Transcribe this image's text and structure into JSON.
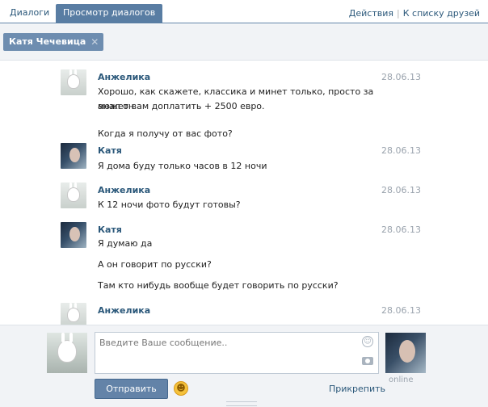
{
  "tabs": [
    {
      "label": "Диалоги"
    },
    {
      "label": "Просмотр диалогов"
    }
  ],
  "header_links": {
    "actions": "Действия",
    "back_to_friends": "К списку друзей"
  },
  "chip": {
    "label": "Катя Чечевица"
  },
  "messages": [
    {
      "author": "Анжелика",
      "date": "28.06.13",
      "avatar": "bunny-avatar",
      "lines": [
        "Хорошо, как скажете, классика и минет только, просто за анал он",
        "может вам доплатить + 2500 евро.",
        "Когда я получу от вас фото?"
      ]
    },
    {
      "author": "Катя",
      "date": "28.06.13",
      "avatar": "girl-avatar",
      "lines": [
        "Я дома буду только часов в 12 ночи"
      ]
    },
    {
      "author": "Анжелика",
      "date": "28.06.13",
      "avatar": "bunny-avatar",
      "lines": [
        "К 12 ночи фото будут готовы?"
      ]
    },
    {
      "author": "Катя",
      "date": "28.06.13",
      "avatar": "girl-avatar",
      "lines": [
        "Я думаю да",
        "А он говорит по русски?",
        "Там кто нибудь вообще будет говорить по русски?"
      ]
    },
    {
      "author": "Анжелика",
      "date": "28.06.13",
      "avatar": "bunny-avatar",
      "lines": []
    }
  ],
  "composer": {
    "placeholder": "Введите Ваше сообщение..",
    "send_label": "Отправить",
    "attach_label": "Прикрепить",
    "status": "online"
  },
  "colors": {
    "accent": "#597da3",
    "link": "#2b587a",
    "button": "#6383a8",
    "panel_bg": "#f1f3f6"
  }
}
